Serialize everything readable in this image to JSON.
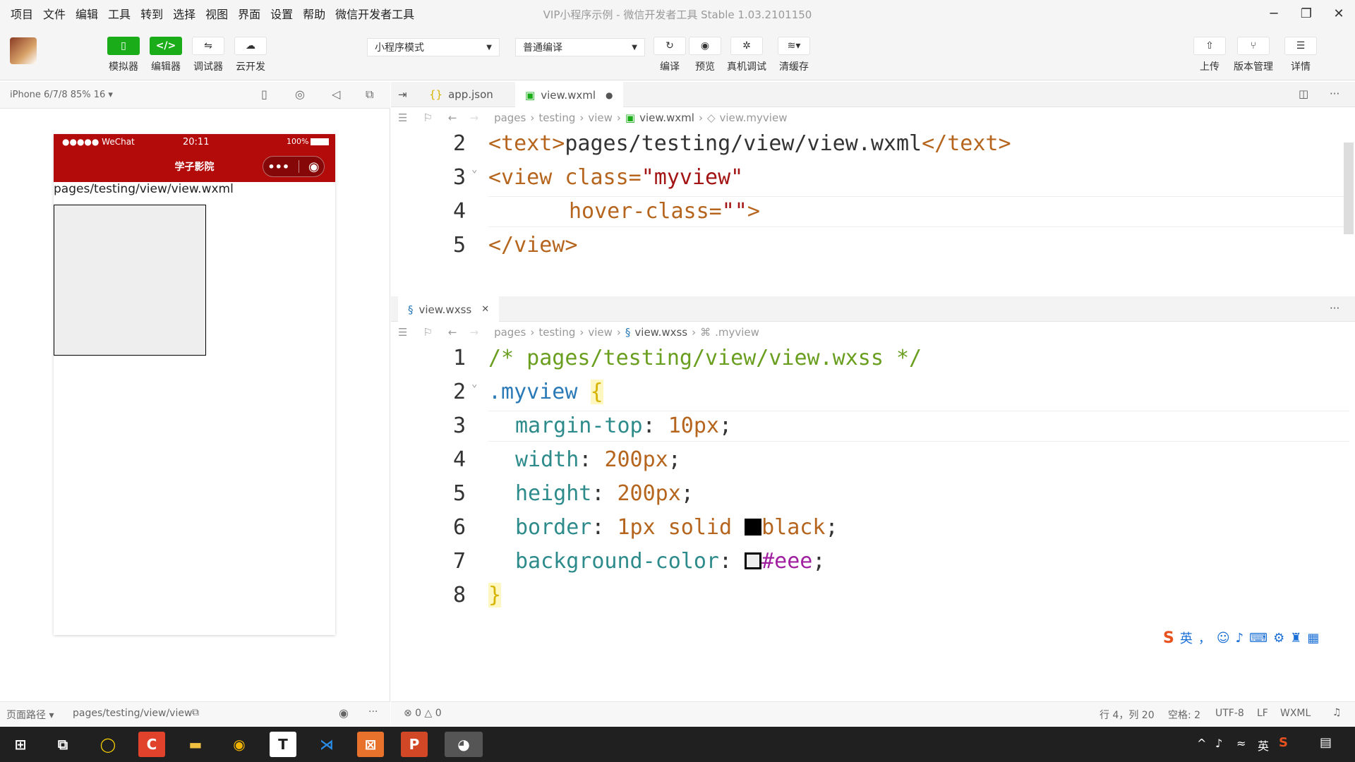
{
  "menu": [
    "项目",
    "文件",
    "编辑",
    "工具",
    "转到",
    "选择",
    "视图",
    "界面",
    "设置",
    "帮助",
    "微信开发者工具"
  ],
  "window_title": "VIP小程序示例 - 微信开发者工具 Stable 1.03.2101150",
  "toolbar": {
    "simulator": "模拟器",
    "editor": "编辑器",
    "debugger": "调试器",
    "cloud": "云开发",
    "mode_select": "小程序模式",
    "compile_select": "普通编译",
    "compile": "编译",
    "preview": "预览",
    "remote_debug": "真机调试",
    "clear_cache": "清缓存",
    "upload": "上传",
    "version": "版本管理",
    "details": "详情"
  },
  "simulator": {
    "device": "iPhone 6/7/8 85% 16 ▾",
    "status_left": "●●●●● WeChat",
    "status_time": "20:11",
    "status_battery": "100%",
    "nav_title": "学子影院",
    "page_text": "pages/testing/view/view.wxml",
    "footer_label": "页面路径 ▾",
    "footer_path": "pages/testing/view/view"
  },
  "editor_top": {
    "tabs": [
      {
        "label": "app.json"
      },
      {
        "label": "view.wxml"
      }
    ],
    "crumbs": [
      "pages",
      "testing",
      "view",
      "view.wxml",
      "view.myview"
    ],
    "lines": [
      {
        "n": "2"
      },
      {
        "n": "3"
      },
      {
        "n": "4"
      },
      {
        "n": "5"
      }
    ],
    "code": {
      "l2_open": "<text>",
      "l2_text": "pages/testing/view/view.wxml",
      "l2_close": "</text>",
      "l3_tag": "<view",
      "l3_attr": " class=",
      "l3_val": "\"myview\"",
      "l4_attr": "hover-class=",
      "l4_val": "\"\"",
      "l4_end": ">",
      "l5": "</view>"
    }
  },
  "editor_bottom": {
    "tab": "view.wxss",
    "crumbs": [
      "pages",
      "testing",
      "view",
      "view.wxss",
      ".myview"
    ],
    "lines": [
      "1",
      "2",
      "3",
      "4",
      "5",
      "6",
      "7",
      "8"
    ],
    "code": {
      "l1": "/* pages/testing/view/view.wxss */",
      "l2_sel": ".myview",
      "l2_brace": "{",
      "l3_prop": "margin-top",
      "l3_val": "10px",
      "l4_prop": "width",
      "l4_val": "200px",
      "l5_prop": "height",
      "l5_val": "200px",
      "l6_prop": "border",
      "l6_val": "1px solid",
      "l6_color": "black",
      "l7_prop": "background-color",
      "l7_color": "#eee",
      "l8": "}"
    }
  },
  "statusbar": {
    "problems": "⊗ 0 △ 0",
    "position": "行 4，列 20",
    "spaces": "空格: 2",
    "encoding": "UTF-8",
    "eol": "LF",
    "lang": "WXML"
  },
  "ime": {
    "lang": "英"
  },
  "taskbar": {
    "tray_lang": "英"
  },
  "colors": {
    "accent": "#1aad19",
    "nav_red": "#b30a0a"
  }
}
